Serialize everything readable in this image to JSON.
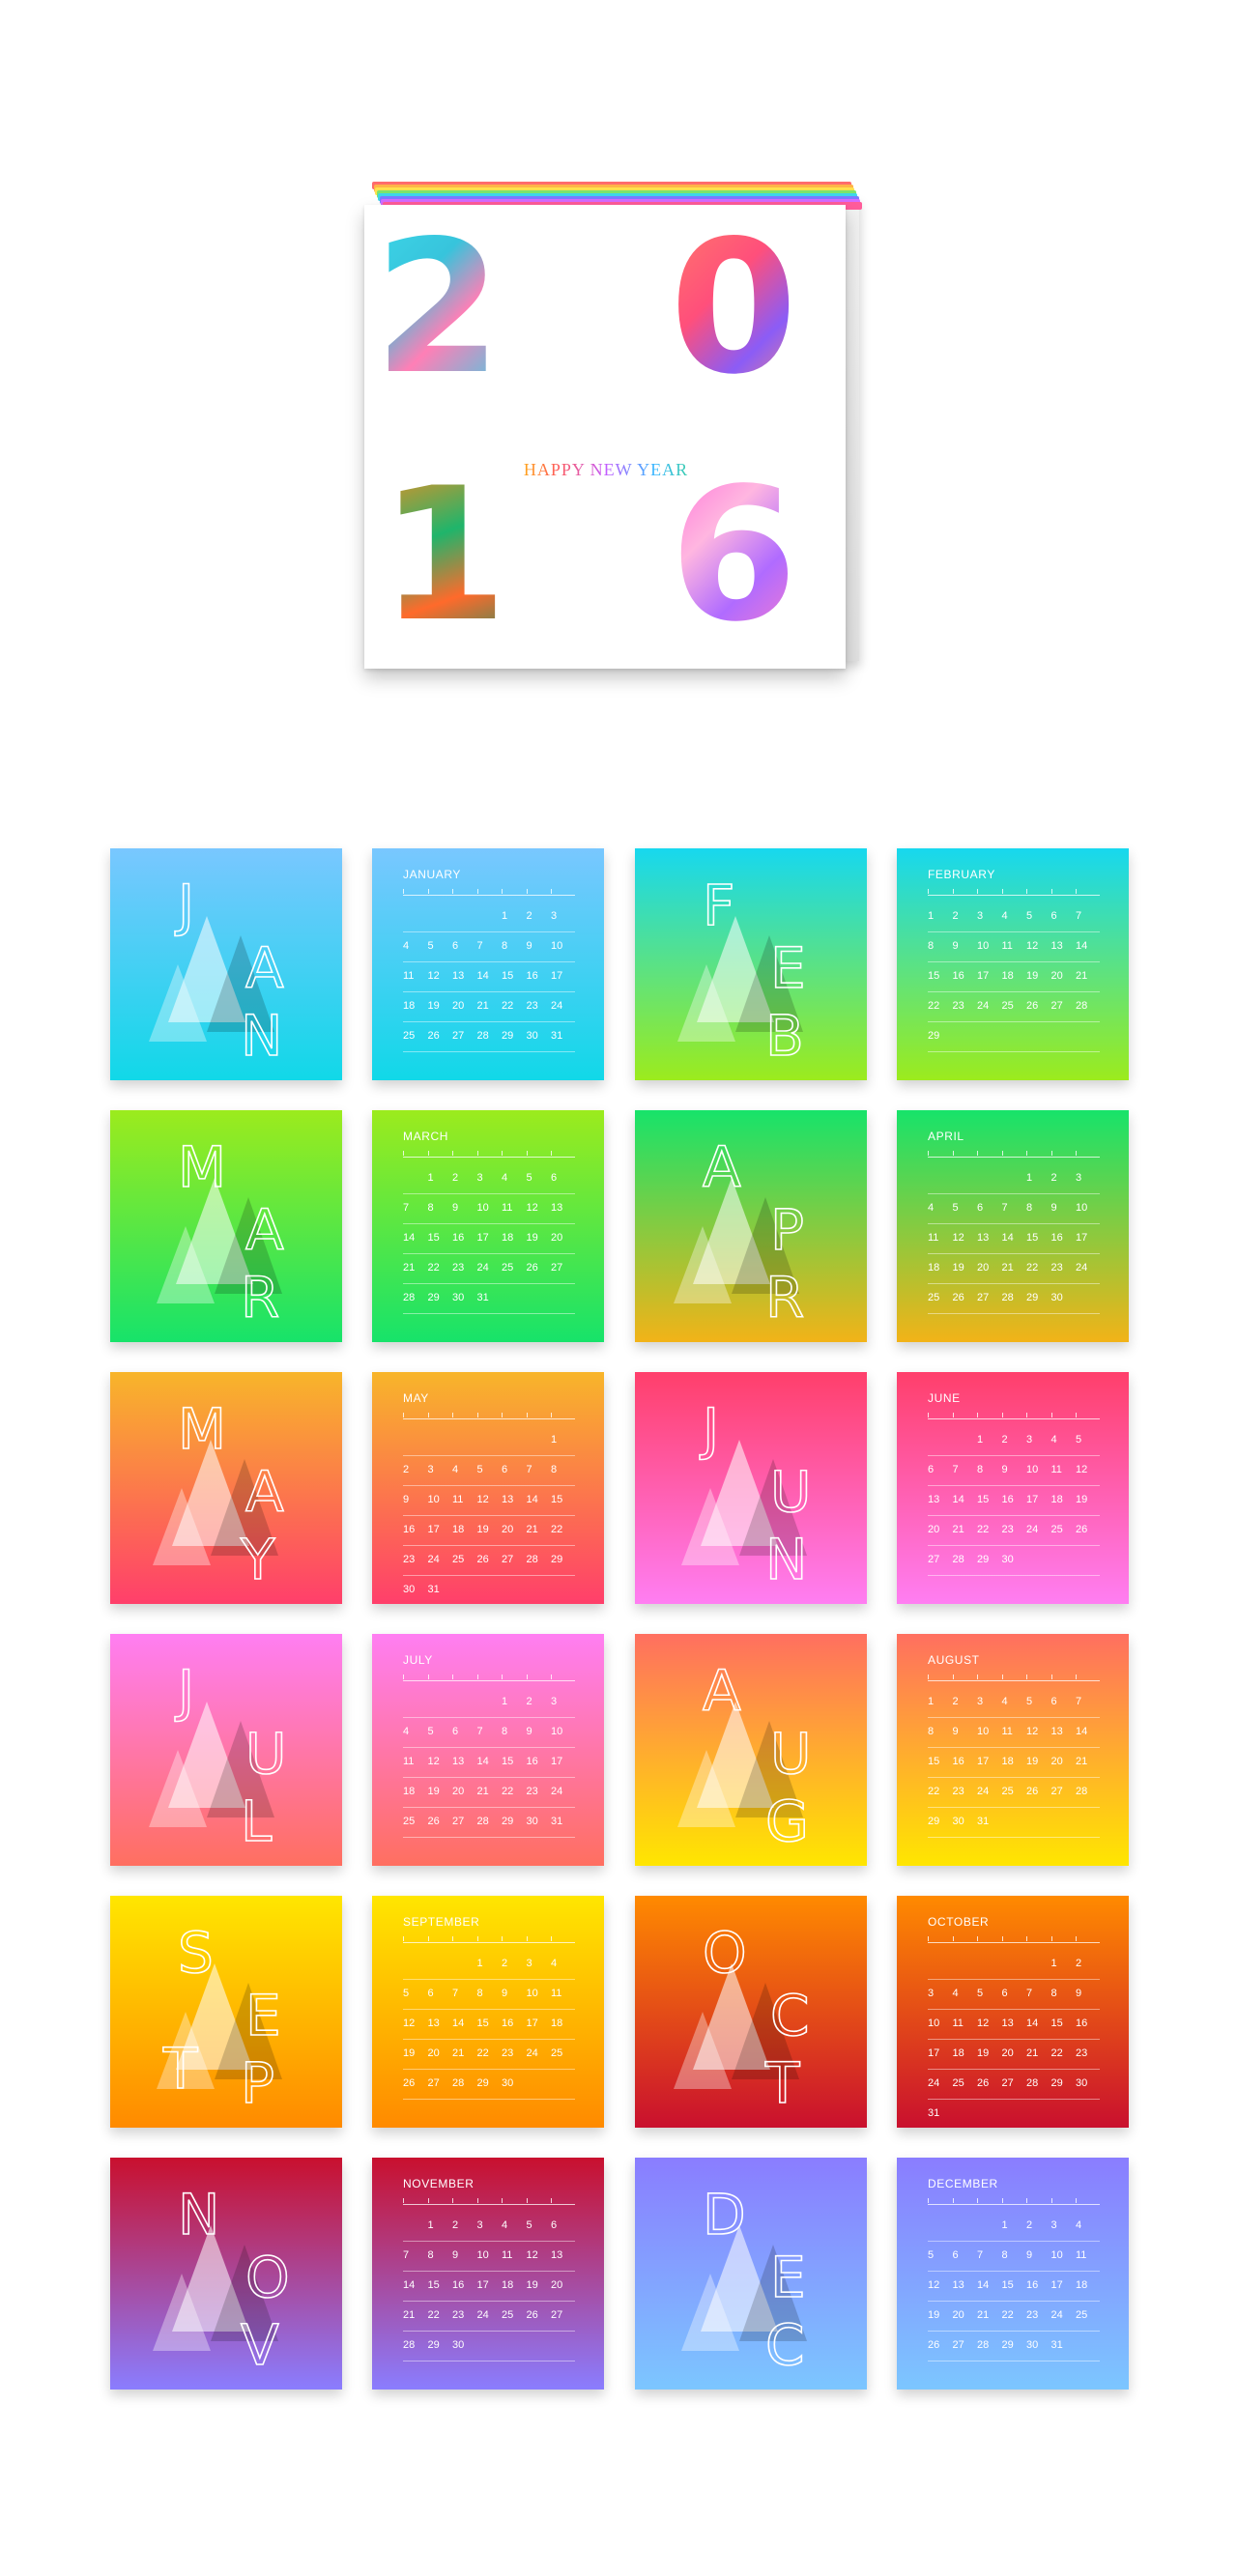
{
  "cover": {
    "digits": [
      "2",
      "0",
      "1",
      "6"
    ],
    "greeting": "HAPPY NEW YEAR",
    "stack_colors": [
      "#ff6b6b",
      "#ffb347",
      "#ffe14d",
      "#7ee36b",
      "#3dd6e8",
      "#7a7bff",
      "#d46bff",
      "#ff5c9a"
    ]
  },
  "months": [
    {
      "name": "JANUARY",
      "art": "JAN",
      "grad": [
        "#79c7ff",
        "#11d8e8"
      ],
      "offset": 4,
      "days": 31
    },
    {
      "name": "FEBRUARY",
      "art": "FEB",
      "grad": [
        "#17d8ef",
        "#9ceb1d"
      ],
      "offset": 0,
      "days": 29
    },
    {
      "name": "MARCH",
      "art": "MAR",
      "grad": [
        "#9ceb1d",
        "#17e36a"
      ],
      "offset": 1,
      "days": 31
    },
    {
      "name": "APRIL",
      "art": "APR",
      "grad": [
        "#17e36a",
        "#f2b318"
      ],
      "offset": 4,
      "days": 30
    },
    {
      "name": "MAY",
      "art": "MAY",
      "grad": [
        "#f8b52a",
        "#ff3f6b"
      ],
      "offset": 6,
      "days": 31
    },
    {
      "name": "JUNE",
      "art": "JUN",
      "grad": [
        "#ff3f6b",
        "#ff7ef2"
      ],
      "offset": 2,
      "days": 30
    },
    {
      "name": "JULY",
      "art": "JUL",
      "grad": [
        "#ff7ef2",
        "#ff6f60"
      ],
      "offset": 4,
      "days": 31
    },
    {
      "name": "AUGUST",
      "art": "AUG",
      "grad": [
        "#ff6f60",
        "#ffe600"
      ],
      "offset": 0,
      "days": 31
    },
    {
      "name": "SEPTEMBER",
      "art": "SEPT",
      "grad": [
        "#ffe600",
        "#ff8a00"
      ],
      "offset": 3,
      "days": 30
    },
    {
      "name": "OCTOBER",
      "art": "OCT",
      "grad": [
        "#ff8a00",
        "#c9102e"
      ],
      "offset": 5,
      "days": 31
    },
    {
      "name": "NOVEMBER",
      "art": "NOV",
      "grad": [
        "#c9102e",
        "#8a7dff"
      ],
      "offset": 1,
      "days": 30
    },
    {
      "name": "DECEMBER",
      "art": "DEC",
      "grad": [
        "#8a7dff",
        "#7cc6ff"
      ],
      "offset": 3,
      "days": 31
    }
  ]
}
